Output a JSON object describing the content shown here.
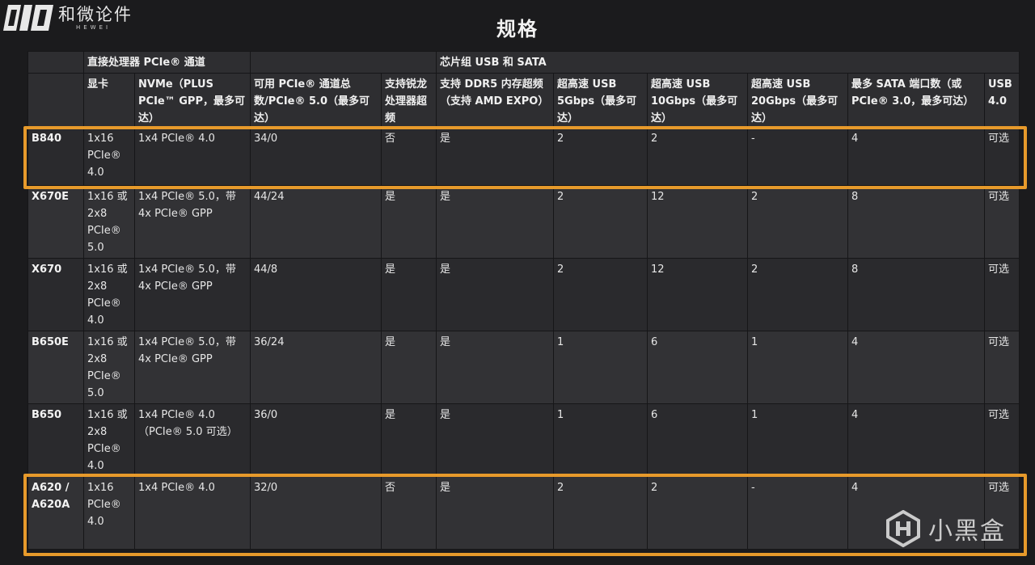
{
  "logo": {
    "name_cn": "和微论件",
    "name_en": "HEWEI"
  },
  "page_title": "规格",
  "table": {
    "group_headers": [
      "",
      "直接处理器 PCIe® 通道",
      "",
      "芯片组 USB 和 SATA"
    ],
    "columns": [
      "",
      "显卡",
      "NVMe（PLUS PCIe™ GPP，最多可达）",
      "可用 PCIe® 通道总数/PCIe® 5.0（最多可达）",
      "支持锐龙处理器超频",
      "支持 DDR5 内存超频（支持 AMD EXPO）",
      "超高速 USB 5Gbps（最多可达）",
      "超高速 USB 10Gbps（最多可达）",
      "超高速 USB 20Gbps（最多可达）",
      "最多 SATA 端口数（或 PCIe® 3.0，最多可达）",
      "USB 4.0"
    ],
    "rows": [
      [
        "B840",
        "1x16 PCIe® 4.0",
        "1x4 PCIe® 4.0",
        "34/0",
        "否",
        "是",
        "2",
        "2",
        "-",
        "4",
        "可选"
      ],
      [
        "X670E",
        "1x16 或 2x8 PCIe® 5.0",
        "1x4 PCIe® 5.0，带 4x PCIe® GPP",
        "44/24",
        "是",
        "是",
        "2",
        "12",
        "2",
        "8",
        "可选"
      ],
      [
        "X670",
        "1x16 或 2x8 PCIe® 4.0",
        "1x4 PCIe® 5.0，带 4x PCIe® GPP",
        "44/8",
        "是",
        "是",
        "2",
        "12",
        "2",
        "8",
        "可选"
      ],
      [
        "B650E",
        "1x16 或 2x8 PCIe® 5.0",
        "1x4 PCIe® 5.0，带 4x PCIe® GPP",
        "36/24",
        "是",
        "是",
        "1",
        "6",
        "1",
        "4",
        "可选"
      ],
      [
        "B650",
        "1x16 或 2x8 PCIe® 4.0",
        "1x4 PCIe® 4.0（PCIe® 5.0 可选）",
        "36/0",
        "是",
        "是",
        "1",
        "6",
        "1",
        "4",
        "可选"
      ],
      [
        "A620 / A620A",
        "1x16 PCIe® 4.0",
        "1x4 PCIe® 4.0",
        "32/0",
        "否",
        "是",
        "2",
        "2",
        "-",
        "4",
        "可选"
      ]
    ]
  },
  "highlight_color": "#e79a2b",
  "watermark": {
    "text": "小黑盒",
    "icon": "xiaoheihe-logo-icon"
  }
}
